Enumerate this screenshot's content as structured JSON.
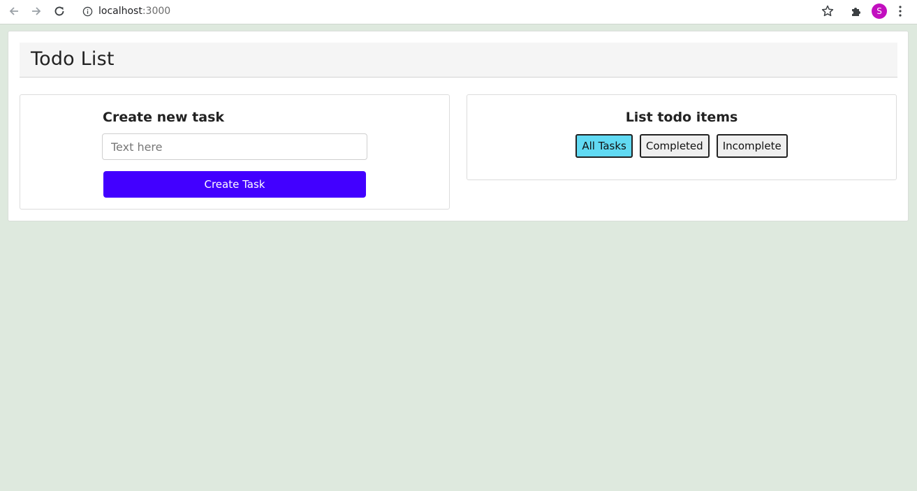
{
  "browser": {
    "url_host": "localhost",
    "url_port": ":3000",
    "profile_initial": "S",
    "icons": {
      "back": "arrow-left-icon",
      "forward": "arrow-right-icon",
      "reload": "reload-icon",
      "info": "info-icon",
      "bookmark": "star-icon",
      "extensions": "puzzle-icon",
      "menu": "kebab-menu-icon"
    }
  },
  "page": {
    "title": "Todo List",
    "create_section": {
      "heading": "Create new task",
      "input_placeholder": "Text here",
      "input_value": "",
      "button_label": "Create Task"
    },
    "list_section": {
      "heading": "List todo items",
      "filters": [
        {
          "label": "All Tasks",
          "active": true
        },
        {
          "label": "Completed",
          "active": false
        },
        {
          "label": "Incomplete",
          "active": false
        }
      ]
    }
  },
  "colors": {
    "page_background": "#dee9de",
    "primary_button": "#4200ff",
    "active_filter": "#61daf3",
    "avatar": "#c20fbf"
  }
}
